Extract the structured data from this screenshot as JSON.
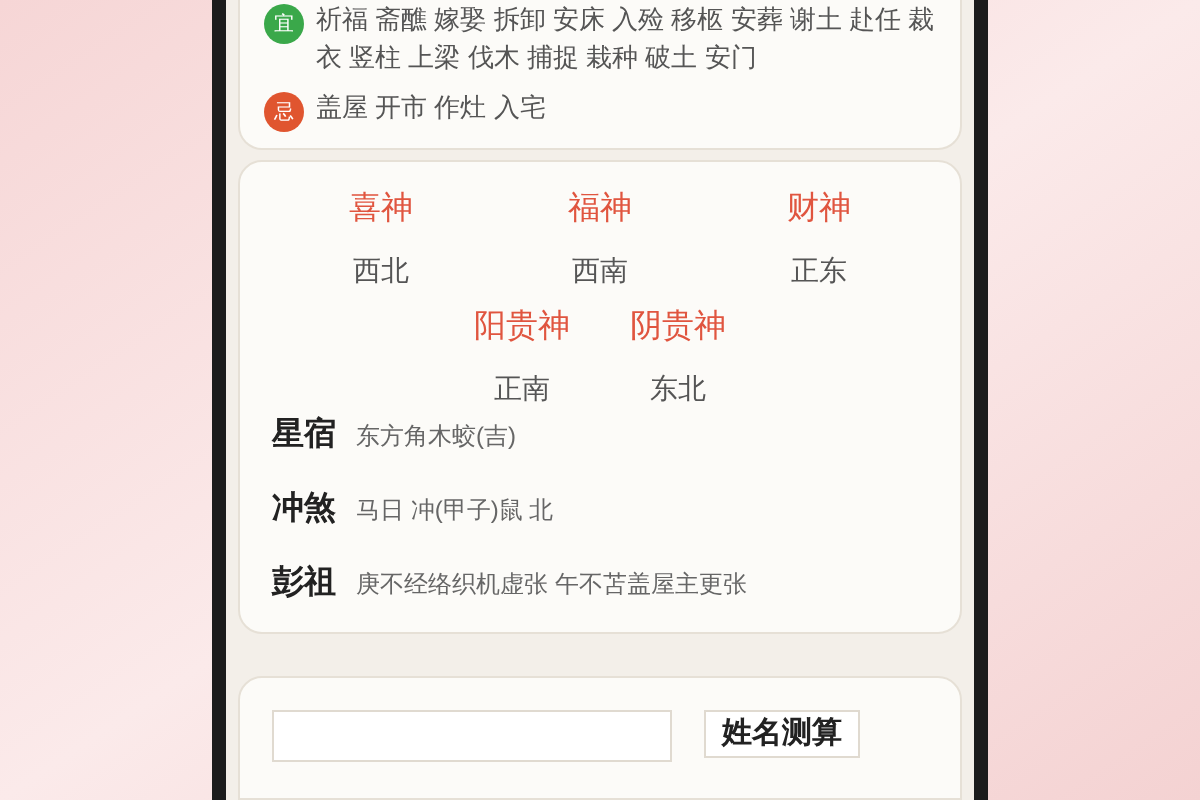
{
  "yi_ji": [
    {
      "kind": "yi",
      "badge": "宜",
      "text": "祈福 斋醮 嫁娶 拆卸 安床 入殓 移柩 安葬 谢土 赴任 裁衣 竖柱 上梁 伐木 捕捉 栽种 破土 安门"
    },
    {
      "kind": "ji",
      "badge": "忌",
      "text": "盖屋 开市 作灶 入宅"
    }
  ],
  "gods_row1": [
    {
      "name": "喜神",
      "direction": "西北"
    },
    {
      "name": "福神",
      "direction": "西南"
    },
    {
      "name": "财神",
      "direction": "正东"
    }
  ],
  "gods_row2": [
    {
      "name": "阳贵神",
      "direction": "正南"
    },
    {
      "name": "阴贵神",
      "direction": "东北"
    }
  ],
  "details": [
    {
      "label": "星宿",
      "value": "东方角木蛟(吉)"
    },
    {
      "label": "冲煞",
      "value": "马日 冲(甲子)鼠 北"
    },
    {
      "label": "彭祖",
      "value": "庚不经络织机虚张 午不苫盖屋主更张"
    }
  ],
  "bottom": {
    "button": "姓名测算"
  }
}
